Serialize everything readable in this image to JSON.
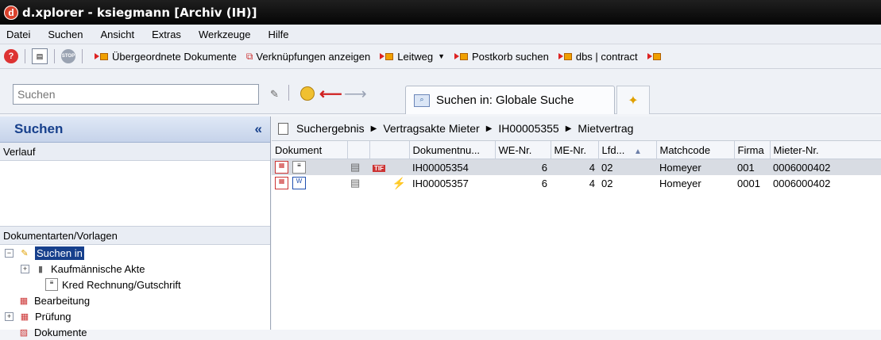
{
  "window": {
    "title": "d.xplorer - ksiegmann [Archiv (IH)]"
  },
  "menu": [
    "Datei",
    "Suchen",
    "Ansicht",
    "Extras",
    "Werkzeuge",
    "Hilfe"
  ],
  "toolbar": {
    "parent_docs": "Übergeordnete Dokumente",
    "links": "Verknüpfungen anzeigen",
    "leitweg": "Leitweg",
    "postkorb": "Postkorb suchen",
    "dbs_contract": "dbs | contract"
  },
  "search": {
    "placeholder": "Suchen"
  },
  "tabs": {
    "search_in": "Suchen in: Globale Suche"
  },
  "left_panel": {
    "title": "Suchen",
    "collapse": "«",
    "history": "Verlauf",
    "doc_types": "Dokumentarten/Vorlagen",
    "tree": {
      "suchen_in": "Suchen in",
      "kaufm": "Kaufmännische Akte",
      "kred": "Kred Rechnung/Gutschrift",
      "bearbeitung": "Bearbeitung",
      "pruefung": "Prüfung",
      "dokumente": "Dokumente"
    }
  },
  "breadcrumb": [
    "Suchergebnis",
    "Vertragsakte Mieter",
    "IH00005355",
    "Mietvertrag"
  ],
  "table": {
    "headers": [
      "Dokument",
      "",
      "",
      "Dokumentnu...",
      "WE-Nr.",
      "ME-Nr.",
      "Lfd...",
      "Matchcode",
      "Firma",
      "Mieter-Nr."
    ],
    "rows": [
      {
        "docnr": "IH00005354",
        "we": "6",
        "me": "4",
        "lfd": "02",
        "match": "Homeyer",
        "firma": "001",
        "mieter": "0006000402"
      },
      {
        "docnr": "IH00005357",
        "we": "6",
        "me": "4",
        "lfd": "02",
        "match": "Homeyer",
        "firma": "0001",
        "mieter": "0006000402"
      }
    ]
  },
  "colors": {
    "selection": "#17408c",
    "accent": "#d22222"
  }
}
